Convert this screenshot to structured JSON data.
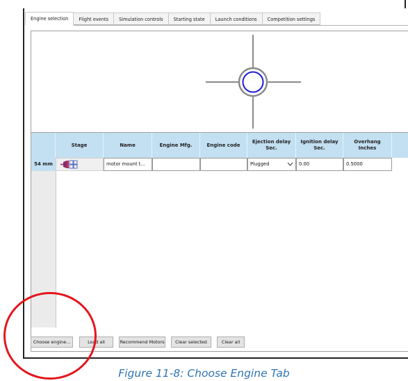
{
  "tabs": [
    {
      "label": "Engine selection",
      "active": true
    },
    {
      "label": "Flight events",
      "active": false
    },
    {
      "label": "Simulation controls",
      "active": false
    },
    {
      "label": "Starting state",
      "active": false
    },
    {
      "label": "Launch conditions",
      "active": false
    },
    {
      "label": "Competition settings",
      "active": false
    }
  ],
  "table": {
    "columns": [
      "Stage",
      "Name",
      "Engine Mfg.",
      "Engine code",
      "Ejection delay Sec.",
      "Ignition delay Sec.",
      "Overhang Inches"
    ],
    "rows": [
      {
        "row_label": "54 mm",
        "name": "motor mount t...",
        "engine_mfg": "",
        "engine_code": "",
        "ejection_delay": "Plugged",
        "ignition_delay": "0.00",
        "overhang": "0.5000"
      }
    ]
  },
  "buttons": {
    "choose_engine": "Choose engine...",
    "load_all": "Load all",
    "recommend_motors": "Recommend Motors",
    "clear_selected": "Clear selected",
    "clear_all": "Clear all"
  },
  "caption": "Figure 11-8: Choose Engine Tab",
  "colors": {
    "header_blue": "#c3dff2",
    "annotation_red": "#e4161c",
    "caption_blue": "#2e74b5",
    "crosshair_ring": "#1f1fd6"
  },
  "icons": {
    "stage": "motor-stage-icon",
    "dropdown": "chevron-down-icon"
  }
}
